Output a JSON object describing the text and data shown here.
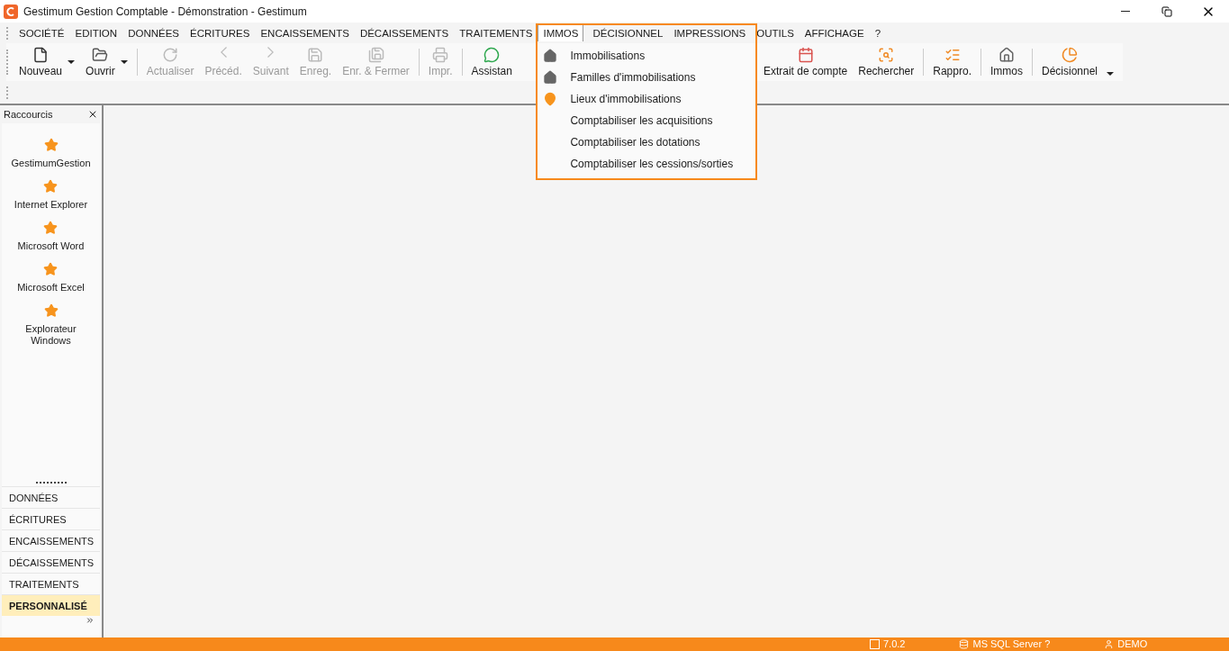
{
  "window": {
    "title": "Gestimum Gestion Comptable - Démonstration - Gestimum"
  },
  "menu_bar": [
    {
      "label": "SOCIÉTÉ",
      "selected": false
    },
    {
      "label": "EDITION",
      "selected": false
    },
    {
      "label": "DONNÉES",
      "selected": false
    },
    {
      "label": "ÉCRITURES",
      "selected": false
    },
    {
      "label": "ENCAISSEMENTS",
      "selected": false
    },
    {
      "label": "DÉCAISSEMENTS",
      "selected": false
    },
    {
      "label": "TRAITEMENTS",
      "selected": false
    },
    {
      "label": "IMMOS",
      "selected": true
    },
    {
      "label": "DÉCISIONNEL",
      "selected": false
    },
    {
      "label": "IMPRESSIONS",
      "selected": false
    },
    {
      "label": "OUTILS",
      "selected": false
    },
    {
      "label": "AFFICHAGE",
      "selected": false
    },
    {
      "label": "?",
      "selected": false
    }
  ],
  "open_menu": {
    "items": [
      {
        "label": "Immobilisations"
      },
      {
        "label": "Familles d'immobilisations"
      },
      {
        "label": "Lieux d'immobilisations"
      },
      {
        "label": "Comptabiliser les acquisitions"
      },
      {
        "label": "Comptabiliser les dotations"
      },
      {
        "label": "Comptabiliser les cessions/sorties"
      }
    ]
  },
  "toolbar_left": [
    {
      "label": "Nouveau",
      "disabled": false,
      "dropdown": true
    },
    {
      "label": "Ouvrir",
      "disabled": false,
      "dropdown": true
    },
    {
      "label": "Actualiser",
      "disabled": true,
      "dropdown": false
    },
    {
      "label": "Précéd.",
      "disabled": true,
      "dropdown": false
    },
    {
      "label": "Suivant",
      "disabled": true,
      "dropdown": false
    },
    {
      "label": "Enreg.",
      "disabled": true,
      "dropdown": false
    },
    {
      "label": "Enr. & Fermer",
      "disabled": true,
      "dropdown": false
    },
    {
      "label": "Impr.",
      "disabled": true,
      "dropdown": false
    },
    {
      "label": "Assistan",
      "disabled": false,
      "dropdown": false
    }
  ],
  "toolbar_right": [
    {
      "label": "Extrait de compte",
      "disabled": false
    },
    {
      "label": "Rechercher",
      "disabled": false
    },
    {
      "label": "Rappro.",
      "disabled": false
    },
    {
      "label": "Immos",
      "disabled": false
    },
    {
      "label": "Décisionnel",
      "disabled": false
    }
  ],
  "shortcuts": {
    "title": "Raccourcis",
    "items": [
      {
        "label": "GestimumGestion"
      },
      {
        "label": "Internet Explorer"
      },
      {
        "label": "Microsoft Word"
      },
      {
        "label": "Microsoft Excel"
      },
      {
        "label": "Explorateur Windows"
      }
    ],
    "sections": [
      {
        "label": "DONNÉES",
        "selected": false
      },
      {
        "label": "ÉCRITURES",
        "selected": false
      },
      {
        "label": "ENCAISSEMENTS",
        "selected": false
      },
      {
        "label": "DÉCAISSEMENTS",
        "selected": false
      },
      {
        "label": "TRAITEMENTS",
        "selected": false
      },
      {
        "label": "PERSONNALISÉ",
        "selected": true
      }
    ]
  },
  "status_bar": {
    "version": "7.0.2",
    "database": "MS SQL Server ?",
    "user": "DEMO"
  }
}
